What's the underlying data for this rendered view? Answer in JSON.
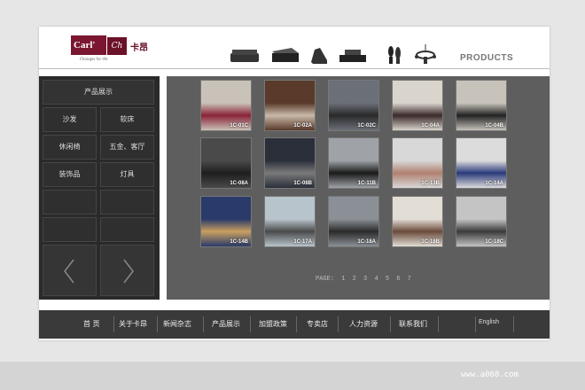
{
  "header": {
    "logo_text": "Carl'",
    "logo_script": "Ch",
    "logo_cn": "卡昂",
    "logo_tagline": "Changes for life",
    "products_title": "PRODUCTS"
  },
  "sidebar": {
    "title": "产品展示",
    "items": [
      {
        "label": "沙发"
      },
      {
        "label": "软床"
      },
      {
        "label": "休闲椅"
      },
      {
        "label": "五金、客厅"
      },
      {
        "label": "装饰品"
      },
      {
        "label": "灯具"
      }
    ]
  },
  "gallery": {
    "thumbs": [
      {
        "label": "1C-01C"
      },
      {
        "label": "1C-02A"
      },
      {
        "label": "1C-02C"
      },
      {
        "label": "1C-04A"
      },
      {
        "label": "1C-04B"
      },
      {
        "label": "1C-08A"
      },
      {
        "label": "1C-08B"
      },
      {
        "label": "1C-11B"
      },
      {
        "label": "1C-13B"
      },
      {
        "label": "1C-14A"
      },
      {
        "label": "1C-14B"
      },
      {
        "label": "1C-17A"
      },
      {
        "label": "1C-18A"
      },
      {
        "label": "1C-18B"
      },
      {
        "label": "1C-18C"
      }
    ],
    "pager_label": "PAGE:",
    "pages": [
      "1",
      "2",
      "3",
      "4",
      "5",
      "6",
      "7"
    ]
  },
  "footer": {
    "menu": [
      "首 页",
      "关于卡昂",
      "新闻杂志",
      "产品展示",
      "加盟政策",
      "专卖店",
      "人力资源",
      "联系我们"
    ],
    "language": "English"
  },
  "watermark": "www.a068.com"
}
